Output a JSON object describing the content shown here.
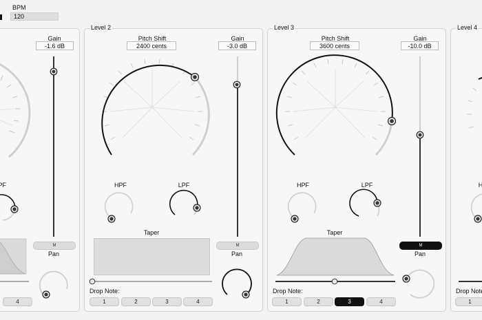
{
  "global": {
    "bpm_label": "BPM",
    "bpm_value": "120"
  },
  "level1": {
    "gain_label": "Gain",
    "gain_value": "-1.6 dB",
    "hpf_label": "HPF",
    "mute_label": "M",
    "pan_label": "Pan",
    "drop_note_4": "4"
  },
  "level2": {
    "title": "Level 2",
    "pitch_label": "Pitch Shift",
    "pitch_value": "2400 cents",
    "gain_label": "Gain",
    "gain_value": "-3.0 dB",
    "hpf_label": "HPF",
    "lpf_label": "LPF",
    "taper_label": "Taper",
    "mute_label": "M",
    "pan_label": "Pan",
    "drop_note_label": "Drop Note:",
    "drop_notes": [
      "1",
      "2",
      "3",
      "4"
    ]
  },
  "level3": {
    "title": "Level 3",
    "pitch_label": "Pitch Shift",
    "pitch_value": "3600 cents",
    "gain_label": "Gain",
    "gain_value": "-10.0 dB",
    "hpf_label": "HPF",
    "lpf_label": "LPF",
    "taper_label": "Taper",
    "mute_label": "M",
    "pan_label": "Pan",
    "drop_note_label": "Drop Note:",
    "drop_notes": [
      "1",
      "2",
      "3",
      "4"
    ],
    "selected_drop_note": "3",
    "mute_active": true
  },
  "level4": {
    "title": "Level 4",
    "drop_note_label": "Drop Note:",
    "drop_note_1": "1"
  }
}
